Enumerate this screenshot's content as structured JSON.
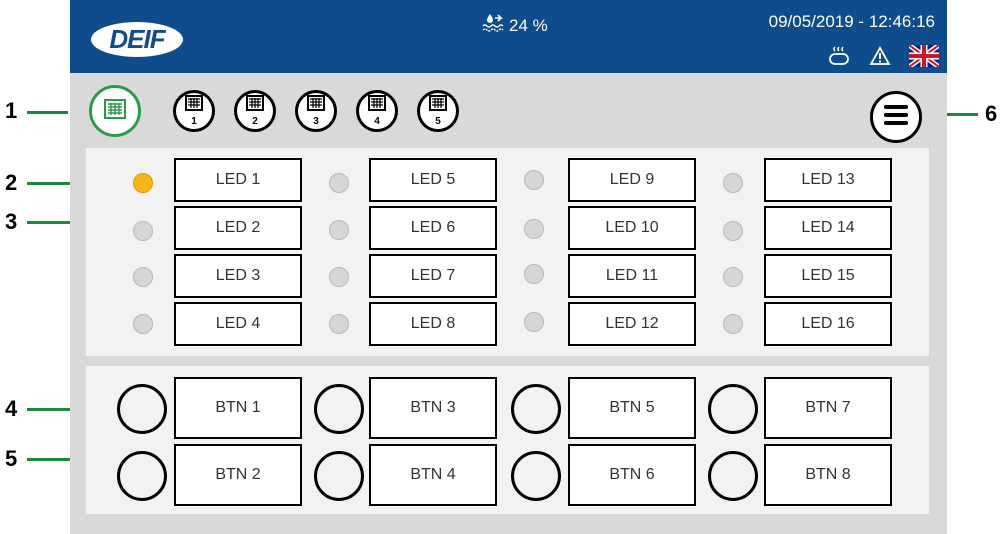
{
  "header": {
    "logo": "DEIF",
    "fuel_level": "24 %",
    "datetime": "09/05/2019 - 12:46:16",
    "icons": [
      "fuel-level-icon",
      "heater-icon",
      "warning-icon",
      "uk-flag-icon"
    ]
  },
  "callouts": [
    "1",
    "2",
    "3",
    "4",
    "5",
    "6"
  ],
  "pages": [
    "1",
    "2",
    "3",
    "4",
    "5"
  ],
  "leds": [
    {
      "label": "LED 1",
      "on": true
    },
    {
      "label": "LED 2",
      "on": false
    },
    {
      "label": "LED 3",
      "on": false
    },
    {
      "label": "LED 4",
      "on": false
    },
    {
      "label": "LED 5",
      "on": false
    },
    {
      "label": "LED 6",
      "on": false
    },
    {
      "label": "LED 7",
      "on": false
    },
    {
      "label": "LED 8",
      "on": false
    },
    {
      "label": "LED 9",
      "on": false
    },
    {
      "label": "LED 10",
      "on": false
    },
    {
      "label": "LED 11",
      "on": false
    },
    {
      "label": "LED 12",
      "on": false
    },
    {
      "label": "LED 13",
      "on": false
    },
    {
      "label": "LED 14",
      "on": false
    },
    {
      "label": "LED 15",
      "on": false
    },
    {
      "label": "LED 16",
      "on": false
    }
  ],
  "buttons": [
    "BTN 1",
    "BTN 2",
    "BTN 3",
    "BTN 4",
    "BTN 5",
    "BTN 6",
    "BTN 7",
    "BTN 8"
  ],
  "colors": {
    "header_bg": "#0f4c8c",
    "active_page": "#2b9a4a",
    "led_on": "#f7b719",
    "led_off": "#d6d6d6",
    "callout_line": "#1a8a3a"
  }
}
